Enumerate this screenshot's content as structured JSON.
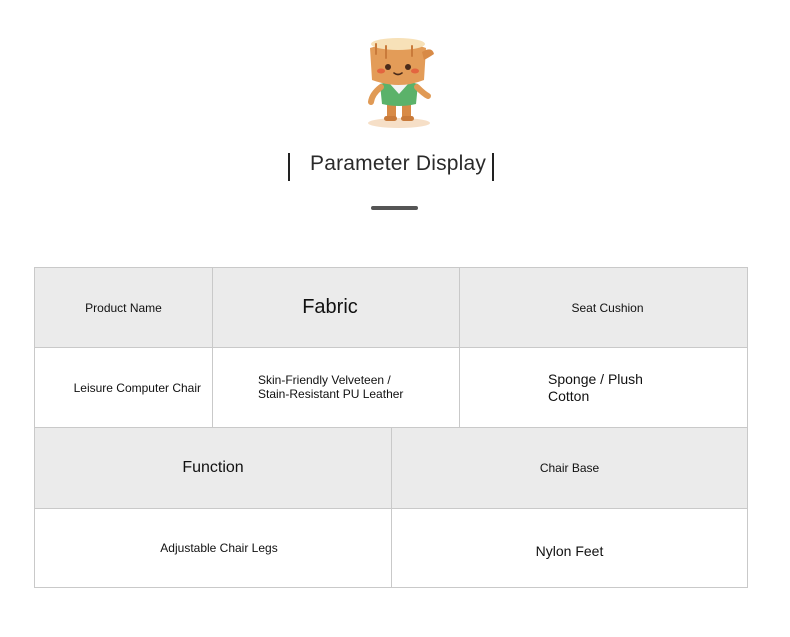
{
  "header": {
    "title": "Parameter Display"
  },
  "table": {
    "row1": {
      "product_name_label": "Product Name",
      "fabric_label": "Fabric",
      "seat_cushion_label": "Seat Cushion"
    },
    "row2": {
      "product_name_value": "Leisure Computer Chair",
      "fabric_value_line1": "Skin-Friendly Velveteen /",
      "fabric_value_line2": "Stain-Resistant PU Leather",
      "seat_cushion_value_line1": "Sponge / Plush",
      "seat_cushion_value_line2": "Cotton"
    },
    "row3": {
      "function_label": "Function",
      "chair_base_label": "Chair Base"
    },
    "row4": {
      "function_value": "Adjustable Chair Legs",
      "chair_base_value": "Nylon Feet"
    }
  },
  "colors": {
    "header_cell_bg": "#ebebeb",
    "border": "#c9c9c9",
    "mascot_skin": "#e09a55",
    "mascot_shirt": "#5bb26a"
  }
}
